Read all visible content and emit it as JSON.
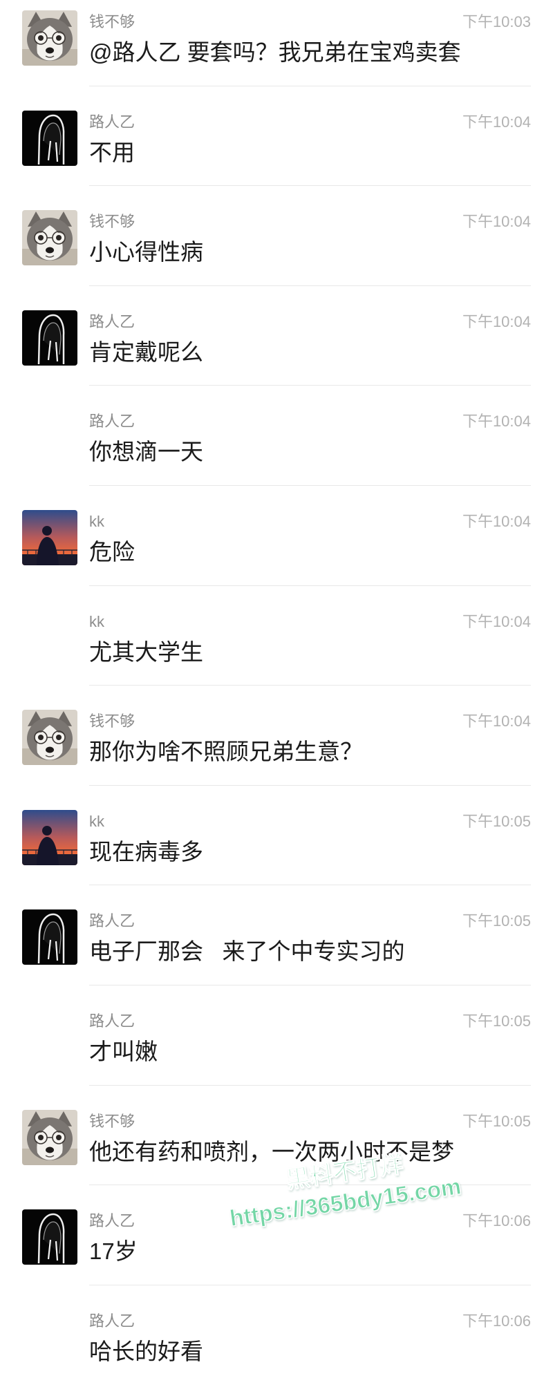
{
  "messages": [
    {
      "sender": "钱不够",
      "time": "下午10:03",
      "text": "@路人乙 要套吗？我兄弟在宝鸡卖套",
      "avatar": "husky-dog-photo"
    },
    {
      "sender": "路人乙",
      "time": "下午10:04",
      "text": "不用",
      "avatar": "hooded-figure-photo"
    },
    {
      "sender": "钱不够",
      "time": "下午10:04",
      "text": "小心得性病",
      "avatar": "husky-dog-photo"
    },
    {
      "sender": "路人乙",
      "time": "下午10:04",
      "text": "肯定戴呢么",
      "avatar": "hooded-figure-photo"
    },
    {
      "sender": "路人乙",
      "time": "下午10:04",
      "text": "你想滴一天",
      "avatar": null
    },
    {
      "sender": "kk",
      "time": "下午10:04",
      "text": "危险",
      "avatar": "sunset-silhouette-photo"
    },
    {
      "sender": "kk",
      "time": "下午10:04",
      "text": "尤其大学生",
      "avatar": null
    },
    {
      "sender": "钱不够",
      "time": "下午10:04",
      "text": "那你为啥不照顾兄弟生意？",
      "avatar": "husky-dog-photo"
    },
    {
      "sender": "kk",
      "time": "下午10:05",
      "text": "现在病毒多",
      "avatar": "sunset-silhouette-photo"
    },
    {
      "sender": "路人乙",
      "time": "下午10:05",
      "text": "电子厂那会   来了个中专实习的",
      "avatar": "hooded-figure-photo"
    },
    {
      "sender": "路人乙",
      "time": "下午10:05",
      "text": "才叫嫩",
      "avatar": null
    },
    {
      "sender": "钱不够",
      "time": "下午10:05",
      "text": "他还有药和喷剂，一次两小时不是梦",
      "avatar": "husky-dog-photo"
    },
    {
      "sender": "路人乙",
      "time": "下午10:06",
      "text": "17岁",
      "avatar": "hooded-figure-photo"
    },
    {
      "sender": "路人乙",
      "time": "下午10:06",
      "text": "哈长的好看",
      "avatar": null
    }
  ],
  "watermark": {
    "line1": "黑料不打烊",
    "line2": "https://365bdy15.com",
    "color": "#74d6a6"
  },
  "colors": {
    "background": "#ffffff",
    "sender": "#8c8c8c",
    "time": "#b2b2b2",
    "text": "#1b1b1b",
    "divider": "#e8e8e8"
  }
}
